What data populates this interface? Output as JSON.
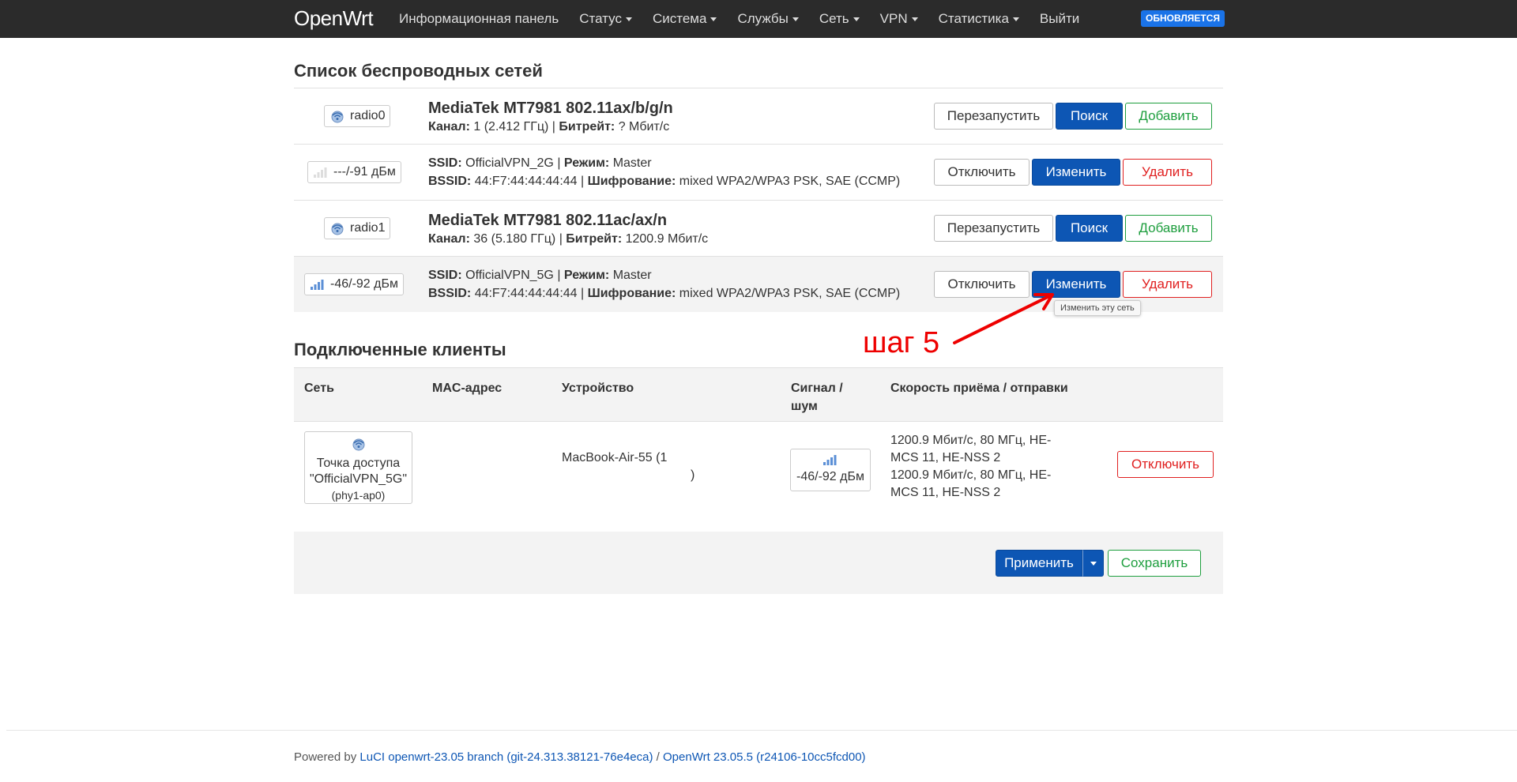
{
  "navbar": {
    "brand": "OpenWrt",
    "menu": [
      {
        "label": "Информационная панель",
        "dropdown": false
      },
      {
        "label": "Статус",
        "dropdown": true
      },
      {
        "label": "Система",
        "dropdown": true
      },
      {
        "label": "Службы",
        "dropdown": true
      },
      {
        "label": "Сеть",
        "dropdown": true
      },
      {
        "label": "VPN",
        "dropdown": true
      },
      {
        "label": "Статистика",
        "dropdown": true
      },
      {
        "label": "Выйти",
        "dropdown": false
      }
    ],
    "update_badge": "ОБНОВЛЯЕТСЯ"
  },
  "wireless": {
    "title": "Список беспроводных сетей",
    "radios": [
      {
        "badge": "radio0",
        "name": "MediaTek MT7981 802.11ax/b/g/n",
        "channel_label": "Канал:",
        "channel": "1 (2.412 ГГц)",
        "bitrate_label": "Битрейт:",
        "bitrate": "? Мбит/с",
        "buttons": {
          "restart": "Перезапустить",
          "scan": "Поиск",
          "add": "Добавить"
        },
        "network": {
          "signal": "---/-91 дБм",
          "ssid_label": "SSID:",
          "ssid": "OfficialVPN_2G",
          "mode_label": "Режим:",
          "mode": "Master",
          "bssid_label": "BSSID:",
          "bssid": "44:F7:44:44:44:44",
          "enc_label": "Шифрование:",
          "enc": "mixed WPA2/WPA3 PSK, SAE (CCMP)",
          "buttons": {
            "disable": "Отключить",
            "edit": "Изменить",
            "delete": "Удалить"
          }
        }
      },
      {
        "badge": "radio1",
        "name": "MediaTek MT7981 802.11ac/ax/n",
        "channel_label": "Канал:",
        "channel": "36 (5.180 ГГц)",
        "bitrate_label": "Битрейт:",
        "bitrate": "1200.9 Мбит/с",
        "buttons": {
          "restart": "Перезапустить",
          "scan": "Поиск",
          "add": "Добавить"
        },
        "network": {
          "signal": "-46/-92 дБм",
          "ssid_label": "SSID:",
          "ssid": "OfficialVPN_5G",
          "mode_label": "Режим:",
          "mode": "Master",
          "bssid_label": "BSSID:",
          "bssid": "44:F7:44:44:44:44",
          "enc_label": "Шифрование:",
          "enc": "mixed WPA2/WPA3 PSK, SAE (CCMP)",
          "buttons": {
            "disable": "Отключить",
            "edit": "Изменить",
            "delete": "Удалить"
          }
        }
      }
    ],
    "tooltip": "Изменить эту сеть"
  },
  "annotation": "шаг 5",
  "clients": {
    "title": "Подключенные клиенты",
    "headers": {
      "network": "Сеть",
      "mac": "MAC-адрес",
      "device": "Устройство",
      "signal_line1": "Сигнал /",
      "signal_line2": "шум",
      "rate": "Скорость приёма / отправки"
    },
    "rows": [
      {
        "ap_line1": "Точка доступа",
        "ap_line2": "\"OfficialVPN_5G\"",
        "ap_line3": "(phy1-ap0)",
        "device": "MacBook-Air-55 (1",
        "device_tail": ")",
        "signal": "-46/-92 дБм",
        "rate_rx": "1200.9 Мбит/с, 80 МГц, HE-MCS 11, HE-NSS 2",
        "rate_tx": "1200.9 Мбит/с, 80 МГц, HE-MCS 11, HE-NSS 2",
        "disconnect": "Отключить"
      }
    ]
  },
  "actions": {
    "apply": "Применить",
    "save": "Сохранить"
  },
  "footer": {
    "prefix": "Powered by ",
    "luci": "LuCI openwrt-23.05 branch (git-24.313.38121-76e4eca)",
    "sep": " / ",
    "openwrt": "OpenWrt 23.05.5 (r24106-10cc5fcd00)"
  },
  "colors": {
    "navbar": "#2b2b2b",
    "primary": "#0d56b4",
    "success": "#1e9e3e",
    "danger": "#e02020",
    "annotation": "#ee0000"
  }
}
